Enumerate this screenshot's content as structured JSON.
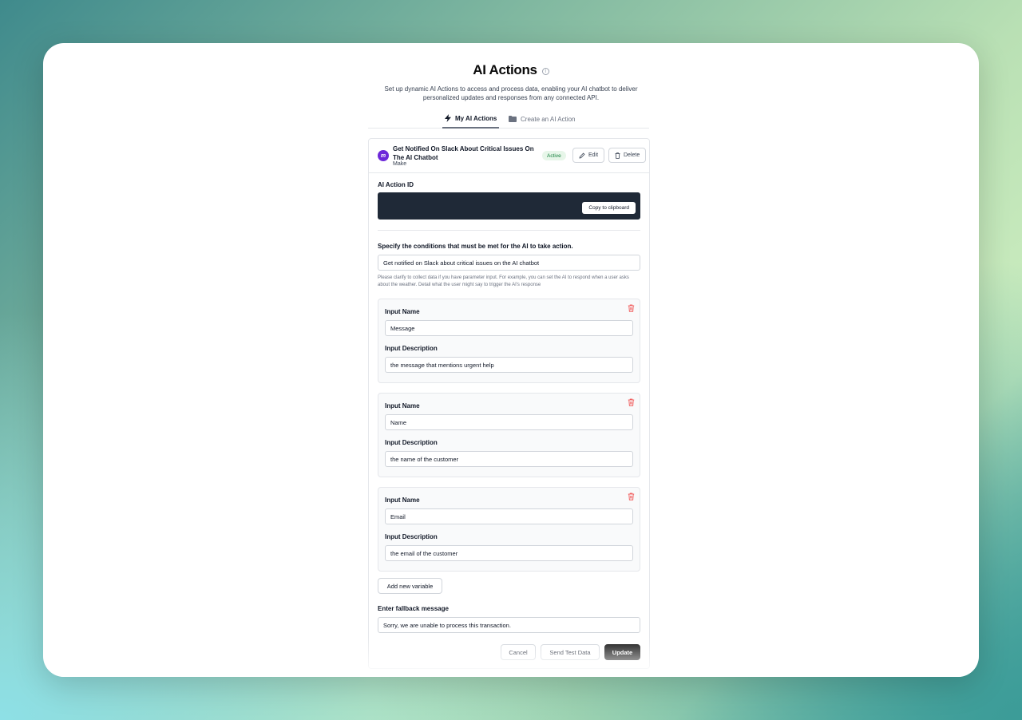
{
  "header": {
    "title": "AI Actions",
    "subtitle": "Set up dynamic AI Actions to access and process data, enabling your AI chatbot to deliver personalized updates and responses from any connected API."
  },
  "tabs": [
    {
      "label": "My AI Actions",
      "icon": "lightning-icon",
      "active": true
    },
    {
      "label": "Create an AI Action",
      "icon": "folder-icon",
      "active": false
    }
  ],
  "action": {
    "title": "Get Notified On Slack About Critical Issues On The AI Chatbot",
    "provider": "Make",
    "logo_letter": "m",
    "status": "Active",
    "edit_label": "Edit",
    "delete_label": "Delete"
  },
  "action_id": {
    "label": "AI Action ID",
    "copy_label": "Copy to clipboard"
  },
  "conditions": {
    "label": "Specify the conditions that must be met for the AI to take action.",
    "value": "Get notified on Slack about critical issues on the AI chatbot",
    "help": "Please clarify to collect data if you have parameter input. For example, you can set the AI to respond when a user asks about the weather. Detail what the user might say to trigger the AI's response"
  },
  "variables": [
    {
      "name_label": "Input Name",
      "name": "Message",
      "desc_label": "Input Description",
      "desc": "the message that mentions urgent help"
    },
    {
      "name_label": "Input Name",
      "name": "Name",
      "desc_label": "Input Description",
      "desc": "the name of the customer"
    },
    {
      "name_label": "Input Name",
      "name": "Email",
      "desc_label": "Input Description",
      "desc": "the email of the customer"
    }
  ],
  "add_variable_label": "Add new variable",
  "fallback": {
    "label": "Enter fallback message",
    "value": "Sorry, we are unable to process this transaction."
  },
  "footer": {
    "cancel": "Cancel",
    "test": "Send Test Data",
    "update": "Update"
  },
  "colors": {
    "accent": "#0a0a0a",
    "badge_bg": "#e7f6e9",
    "badge_text": "#15803d",
    "logo": "#6d28d9",
    "trash": "#ef4444"
  }
}
